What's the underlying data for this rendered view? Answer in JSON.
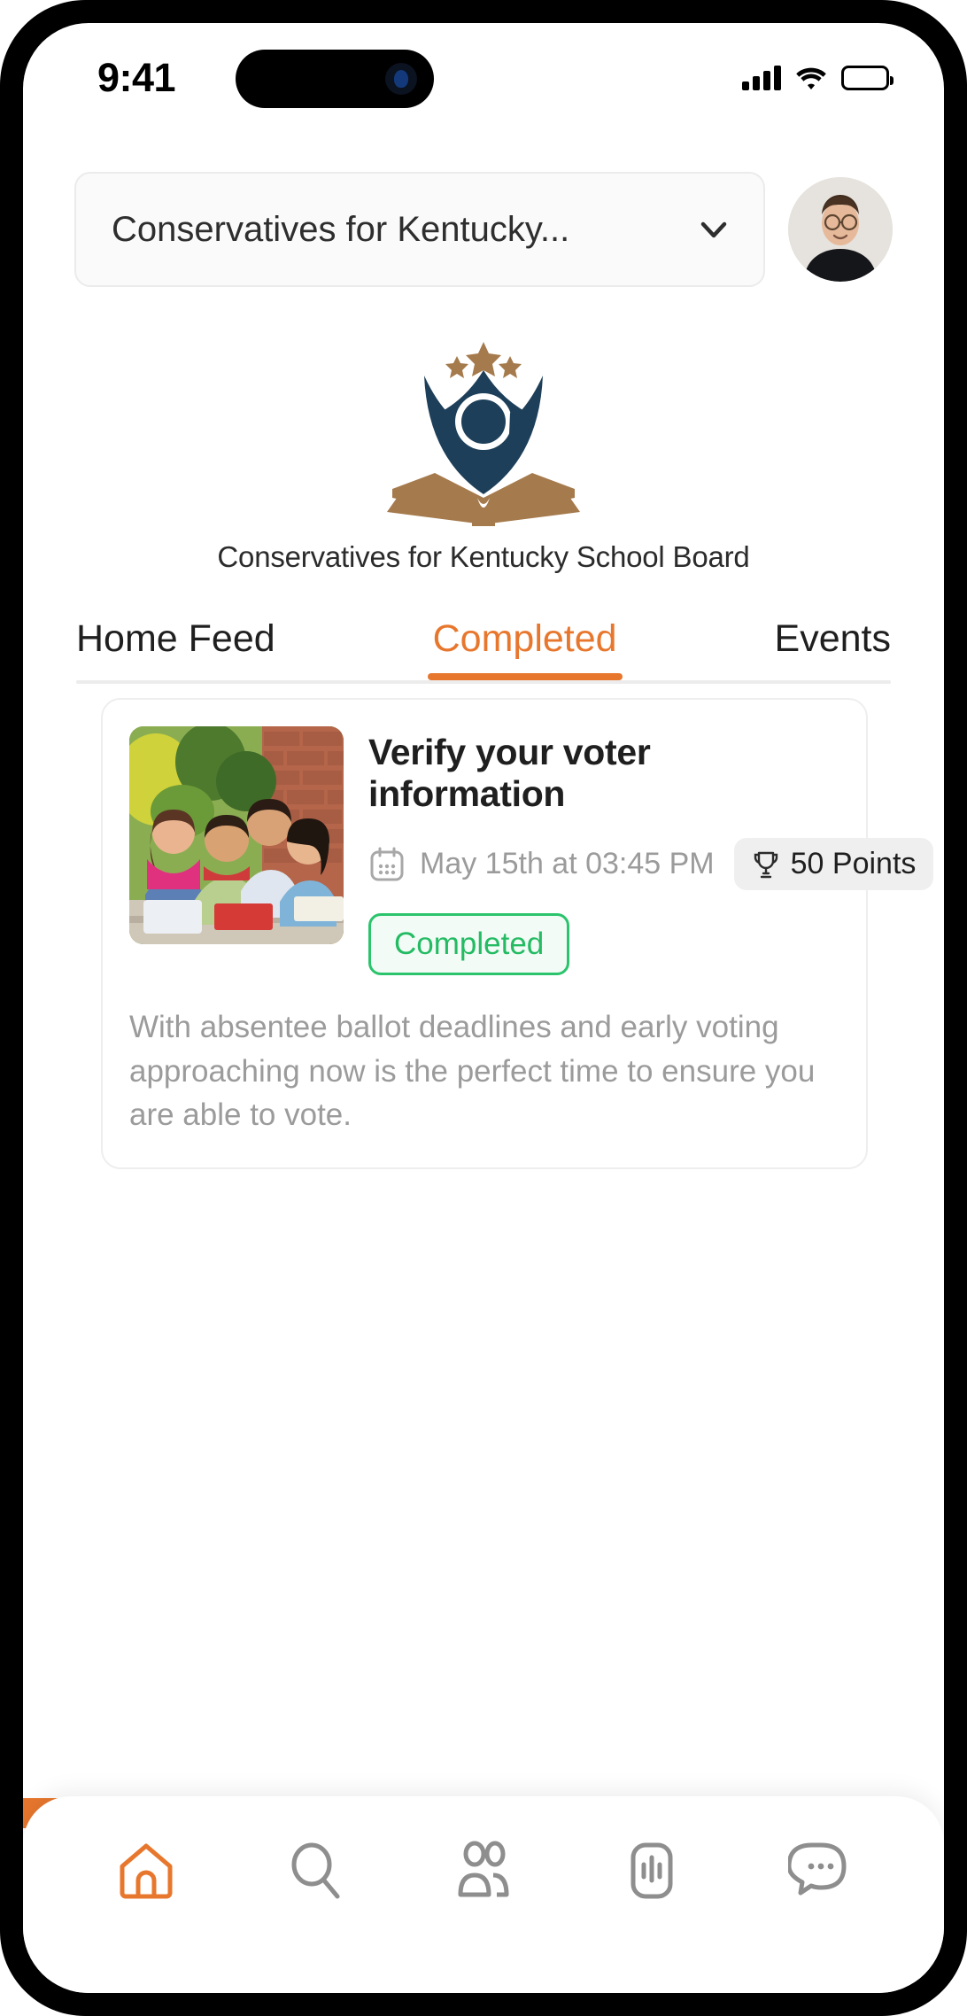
{
  "status_bar": {
    "time": "9:41",
    "signal_icon": "cellular-signal-icon",
    "wifi_icon": "wifi-icon",
    "battery_icon": "battery-full-icon"
  },
  "header": {
    "org_selector_value": "Conservatives for Kentucky...",
    "chevron_icon": "chevron-down-icon",
    "avatar_alt": "user-avatar"
  },
  "brand": {
    "logo_icon": "graduate-book-logo",
    "name": "Conservatives for Kentucky School Board",
    "colors": {
      "navy": "#1d3f59",
      "bronze": "#a57a4c"
    }
  },
  "tabs": {
    "items": [
      {
        "label": "Home Feed",
        "active": false
      },
      {
        "label": "Completed",
        "active": true
      },
      {
        "label": "Events",
        "active": false
      }
    ],
    "active_color": "#e8772e"
  },
  "activity_card": {
    "thumbnail_alt": "students-group-photo",
    "title": "Verify your voter information",
    "calendar_icon": "calendar-icon",
    "date": "May 15th at 03:45 PM",
    "trophy_icon": "trophy-icon",
    "points": "50 Points",
    "status": "Completed",
    "status_color": "#24bb63",
    "description": "With absentee ballot deadlines and early voting approaching now is the perfect time to ensure you are able to vote."
  },
  "bottom_nav": {
    "items": [
      {
        "icon": "home-icon",
        "active": true
      },
      {
        "icon": "search-icon",
        "active": false
      },
      {
        "icon": "people-icon",
        "active": false
      },
      {
        "icon": "chart-icon",
        "active": false
      },
      {
        "icon": "chat-icon",
        "active": false
      }
    ],
    "active_color": "#e8772e",
    "inactive_color": "#8e8e8e"
  }
}
